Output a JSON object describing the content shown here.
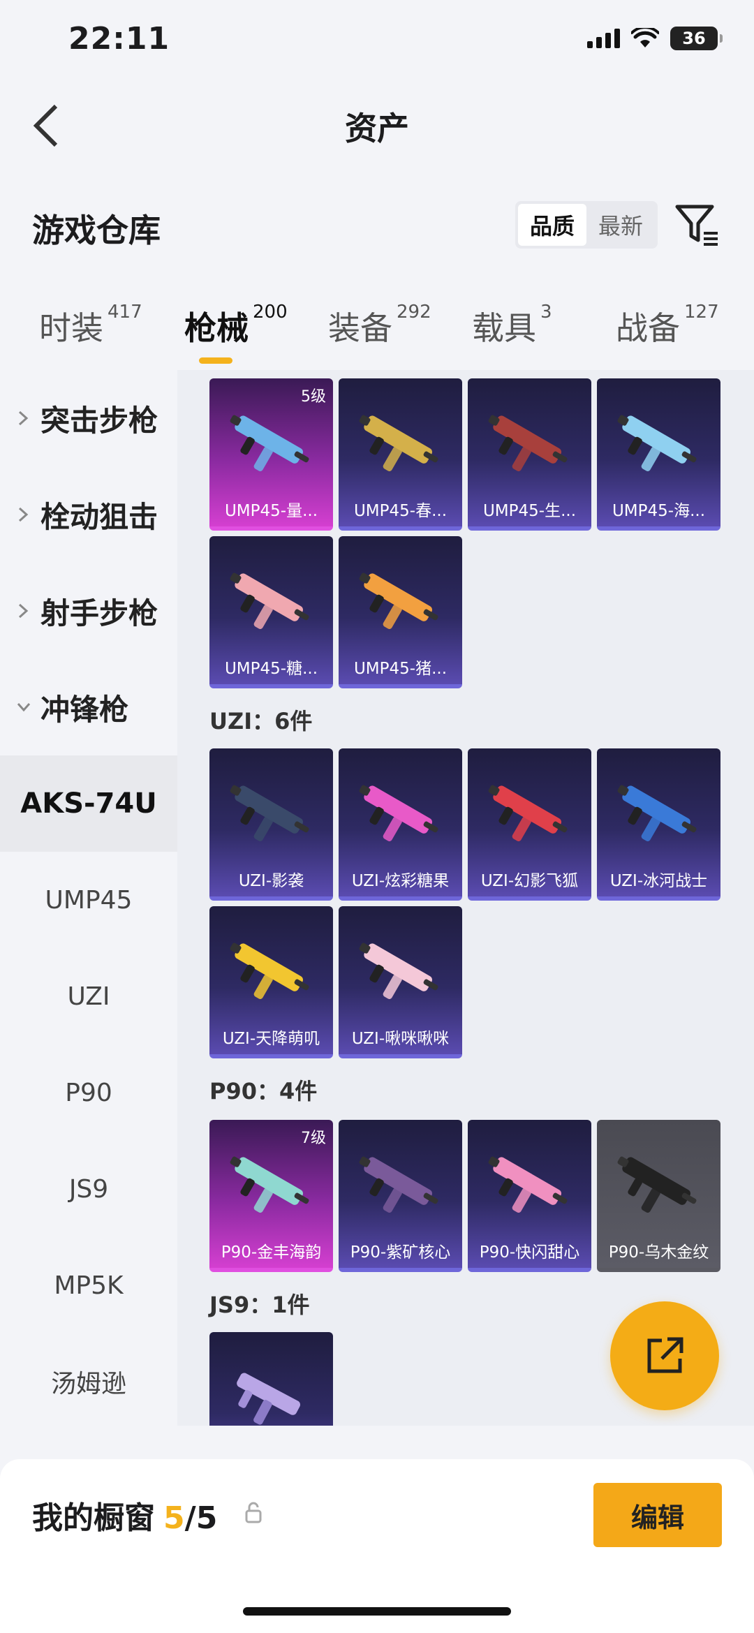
{
  "status": {
    "time": "22:11",
    "battery": "36"
  },
  "header": {
    "title": "资产"
  },
  "section": {
    "title": "游戏仓库",
    "sort_options": [
      "品质",
      "最新"
    ],
    "sort_active": 0
  },
  "tabs": [
    {
      "label": "时装",
      "count": "417"
    },
    {
      "label": "枪械",
      "count": "200"
    },
    {
      "label": "装备",
      "count": "292"
    },
    {
      "label": "载具",
      "count": "3"
    },
    {
      "label": "战备",
      "count": "127"
    }
  ],
  "sidebar": {
    "groups": [
      "突击步枪",
      "栓动狙击",
      "射手步枪",
      "冲锋枪"
    ],
    "subs": [
      "AKS-74U",
      "UMP45",
      "UZI",
      "P90",
      "JS9",
      "MP5K",
      "汤姆逊"
    ]
  },
  "content": {
    "ump45": [
      {
        "name": "UMP45-量...",
        "level": "5级",
        "rarity": "legend"
      },
      {
        "name": "UMP45-春...",
        "rarity": "epic"
      },
      {
        "name": "UMP45-生...",
        "rarity": "epic"
      },
      {
        "name": "UMP45-海...",
        "rarity": "epic"
      },
      {
        "name": "UMP45-糖...",
        "rarity": "epic"
      },
      {
        "name": "UMP45-猪...",
        "rarity": "epic"
      }
    ],
    "uzi_head": "UZI：6件",
    "uzi": [
      {
        "name": "UZI-影袭",
        "rarity": "epic"
      },
      {
        "name": "UZI-炫彩糖果",
        "rarity": "epic"
      },
      {
        "name": "UZI-幻影飞狐",
        "rarity": "epic"
      },
      {
        "name": "UZI-冰河战士",
        "rarity": "epic"
      },
      {
        "name": "UZI-天降萌叽",
        "rarity": "epic"
      },
      {
        "name": "UZI-啾咪啾咪",
        "rarity": "epic"
      }
    ],
    "p90_head": "P90：4件",
    "p90": [
      {
        "name": "P90-金丰海韵",
        "level": "7级",
        "rarity": "legend"
      },
      {
        "name": "P90-紫矿核心",
        "rarity": "epic"
      },
      {
        "name": "P90-快闪甜心",
        "rarity": "epic"
      },
      {
        "name": "P90-乌木金纹",
        "rarity": "grey"
      }
    ],
    "js9_head": "JS9：1件"
  },
  "bottom": {
    "showcase_label": "我的橱窗",
    "current": "5",
    "total": "/5",
    "edit_label": "编辑"
  }
}
